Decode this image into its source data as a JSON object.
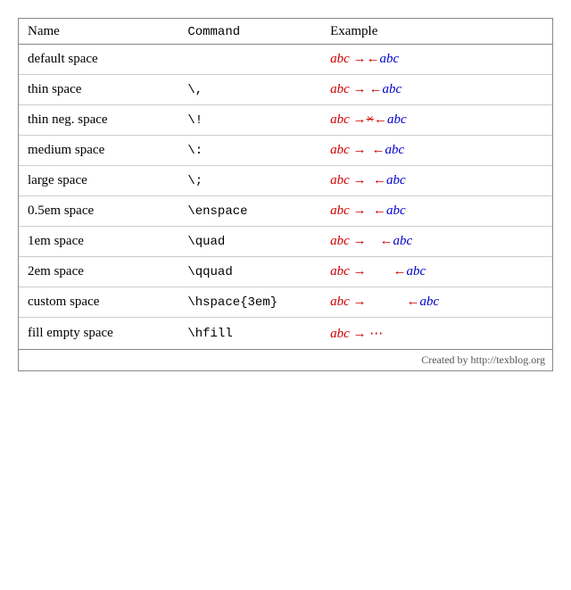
{
  "table": {
    "headers": [
      "Name",
      "Command",
      "Example"
    ],
    "rows": [
      {
        "name": "default space",
        "command": "",
        "example_html": "<span class='red' style='font-style:italic'>abc</span><span class='red'> →←</span><span class='blue' style='font-style:italic'>abc</span>"
      },
      {
        "name": "thin space",
        "command": "\\,",
        "example_html": "<span class='red' style='font-style:italic'>abc</span><span class='red'> → ←</span><span class='blue' style='font-style:italic'>abc</span>"
      },
      {
        "name": "thin neg. space",
        "command": "\\!",
        "example_html": "<span class='red' style='font-style:italic'>abc</span><span class='red'> →&#x200A;←</span><span class='blue' style='font-style:italic'>abc</span>"
      },
      {
        "name": "medium space",
        "command": "\\:",
        "example_html": "<span class='red' style='font-style:italic'>abc</span><span class='red'> →&nbsp;←</span><span class='blue' style='font-style:italic'>abc</span>"
      },
      {
        "name": "large space",
        "command": "\\;",
        "example_html": "<span class='red' style='font-style:italic'>abc</span><span class='red'> →&nbsp;←</span><span class='blue' style='font-style:italic'>abc</span>"
      },
      {
        "name": "0.5em space",
        "command": "\\enspace",
        "example_html": "<span class='red' style='font-style:italic'>abc</span><span class='red'> →&ensp;←</span><span class='blue' style='font-style:italic'>abc</span>"
      },
      {
        "name": "1em space",
        "command": "\\quad",
        "example_html": "<span class='red' style='font-style:italic'>abc</span><span class='red'> →&emsp;←</span><span class='blue' style='font-style:italic'>abc</span>"
      },
      {
        "name": "2em space",
        "command": "\\qquad",
        "example_html": "<span class='red' style='font-style:italic'>abc</span><span class='red'> →&emsp;&emsp;←</span><span class='blue' style='font-style:italic'>abc</span>"
      },
      {
        "name": "custom space",
        "command": "\\hspace{3em}",
        "example_html": "<span class='red' style='font-style:italic'>abc</span><span class='red'> →&emsp;&emsp;&emsp;←</span><span class='blue' style='font-style:italic'>abc</span>"
      },
      {
        "name": "fill empty space",
        "command": "\\hfill",
        "example_html": "<span class='red' style='font-style:italic'>abc</span><span class='red'> → ···</span>"
      }
    ],
    "footer": "Created by http://texblog.org"
  }
}
